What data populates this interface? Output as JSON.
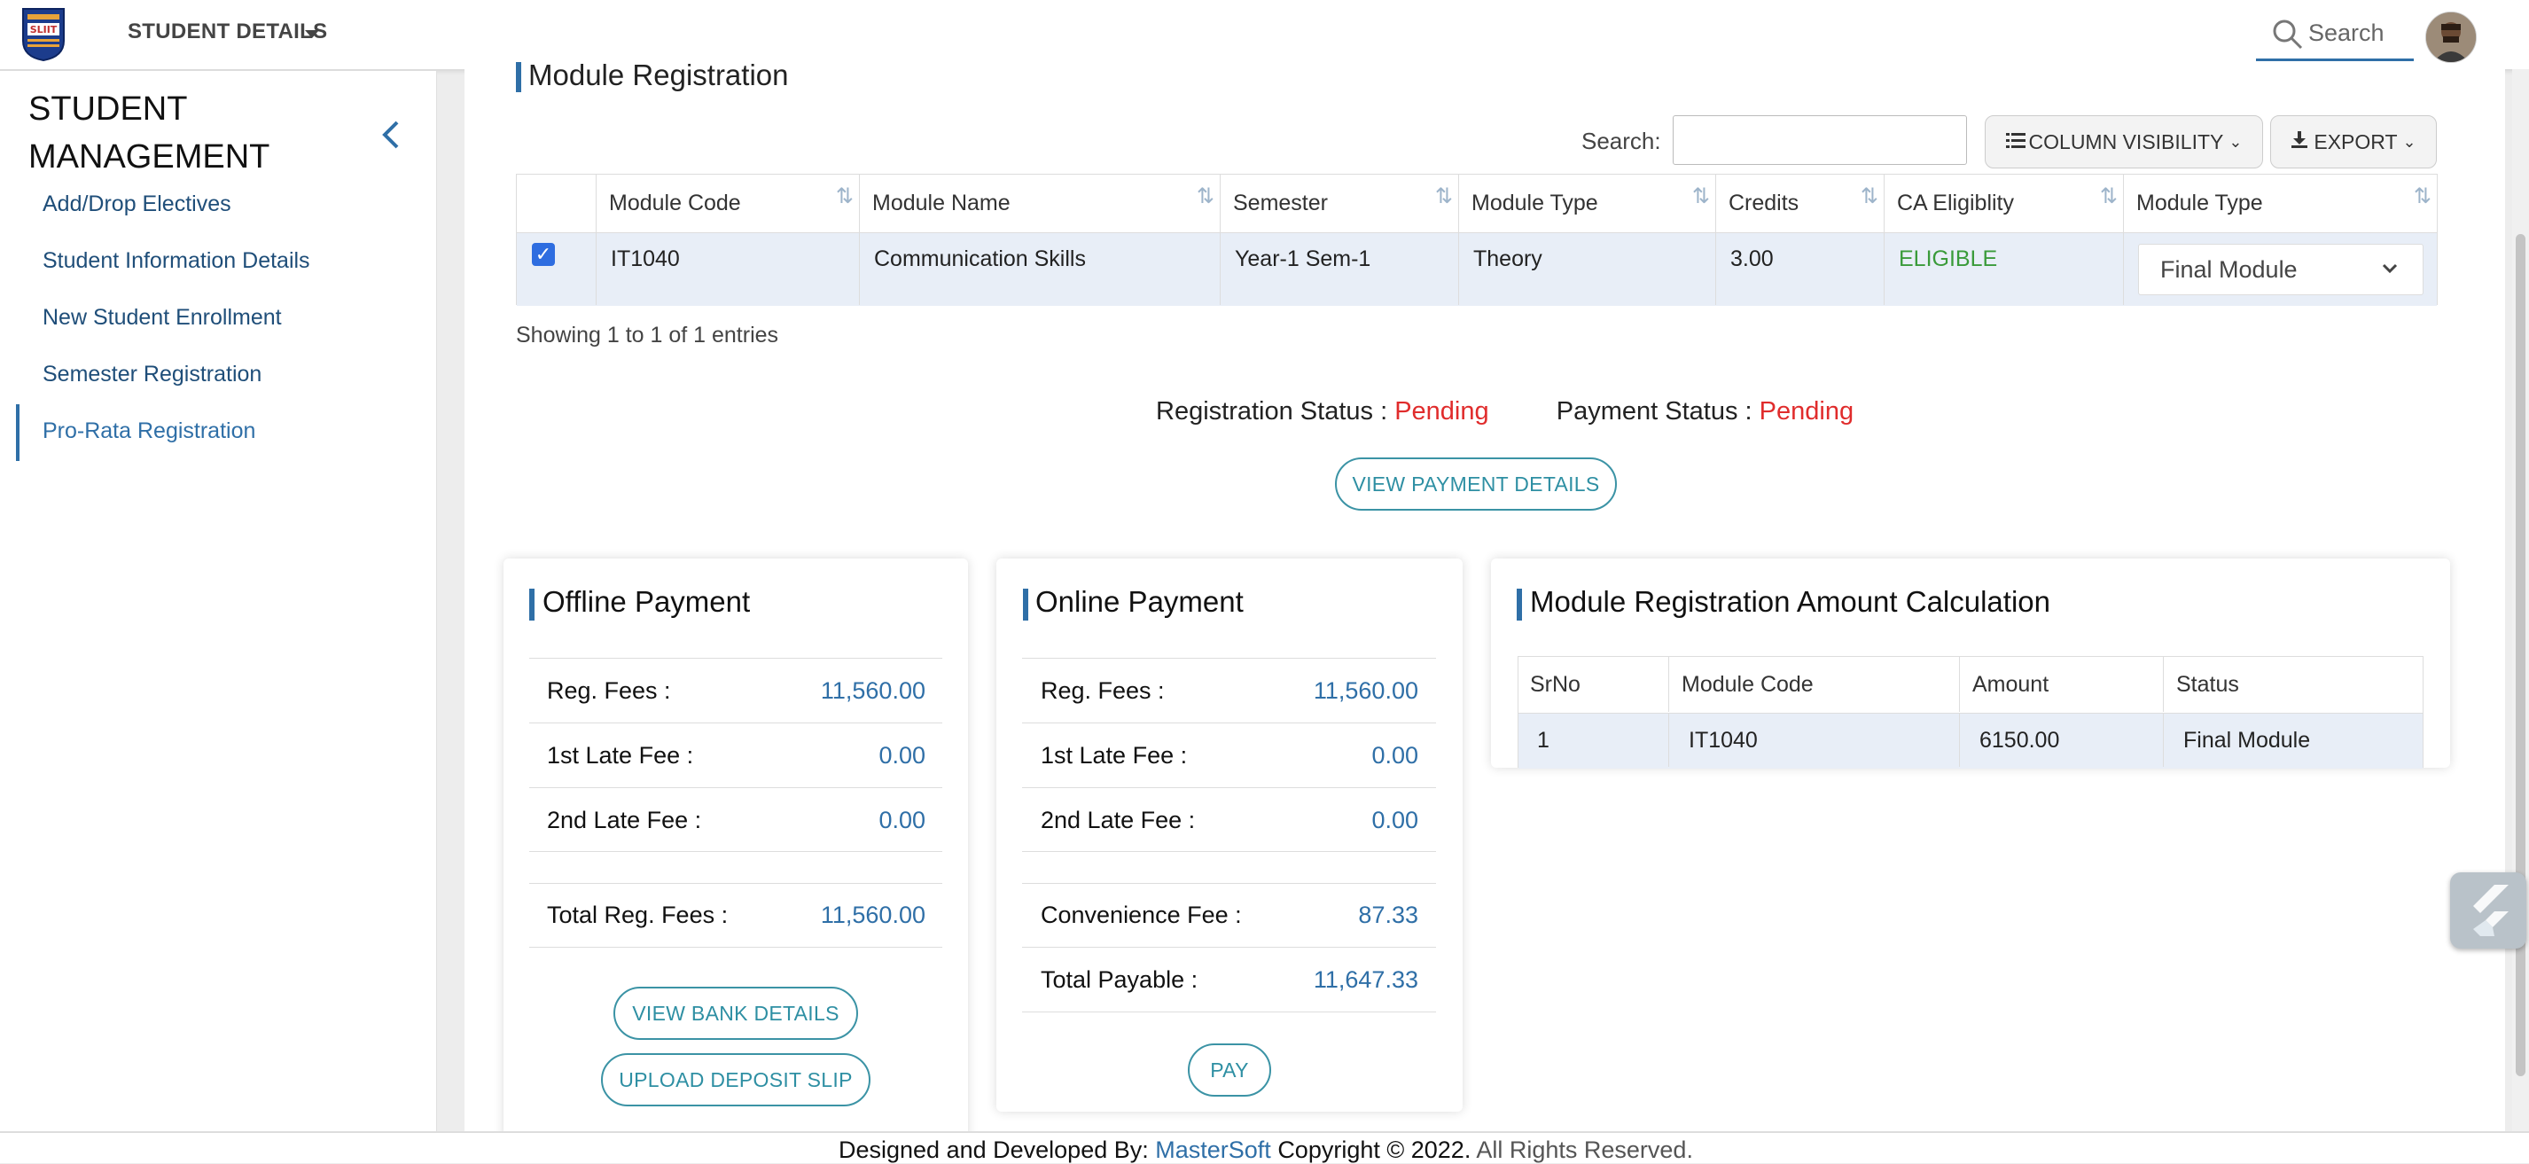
{
  "header": {
    "nav_title": "STUDENT DETAILS",
    "search_label": "Search"
  },
  "sidebar": {
    "title": "STUDENT MANAGEMENT",
    "items": [
      {
        "label": "Add/Drop Electives"
      },
      {
        "label": "Student Information Details"
      },
      {
        "label": "New Student Enrollment"
      },
      {
        "label": "Semester Registration"
      },
      {
        "label": "Pro-Rata Registration"
      }
    ],
    "active_index": 4
  },
  "main": {
    "page_title": "Module Registration",
    "search_label": "Search:",
    "search_value": "",
    "column_visibility_label": "COLUMN VISIBILITY",
    "export_label": "EXPORT",
    "table": {
      "headers": [
        "Module Code",
        "Module Name",
        "Semester",
        "Module Type",
        "Credits",
        "CA Eligiblity",
        "Module Type"
      ],
      "rows": [
        {
          "checked": true,
          "module_code": "IT1040",
          "module_name": "Communication Skills",
          "semester": "Year-1 Sem-1",
          "module_type": "Theory",
          "credits": "3.00",
          "ca_eligibility": "ELIGIBLE",
          "module_type_select": "Final Module"
        }
      ]
    },
    "showing_text": "Showing 1 to 1 of 1 entries",
    "registration_status_label": "Registration Status :",
    "registration_status_value": "Pending",
    "payment_status_label": "Payment Status :",
    "payment_status_value": "Pending",
    "view_payment_details_label": "VIEW PAYMENT DETAILS"
  },
  "offline_payment": {
    "title": "Offline Payment",
    "rows": [
      {
        "label": "Reg. Fees :",
        "value": "11,560.00"
      },
      {
        "label": "1st Late Fee :",
        "value": "0.00"
      },
      {
        "label": "2nd Late Fee :",
        "value": "0.00"
      },
      {
        "label": "Total Reg. Fees :",
        "value": "11,560.00"
      }
    ],
    "view_bank_details_label": "VIEW BANK DETAILS",
    "upload_deposit_slip_label": "UPLOAD DEPOSIT SLIP"
  },
  "online_payment": {
    "title": "Online Payment",
    "rows": [
      {
        "label": "Reg. Fees :",
        "value": "11,560.00"
      },
      {
        "label": "1st Late Fee :",
        "value": "0.00"
      },
      {
        "label": "2nd Late Fee :",
        "value": "0.00"
      },
      {
        "label": "Convenience Fee :",
        "value": "87.33"
      },
      {
        "label": "Total Payable :",
        "value": "11,647.33"
      }
    ],
    "pay_label": "PAY"
  },
  "amount_calc": {
    "title": "Module Registration Amount Calculation",
    "headers": [
      "SrNo",
      "Module Code",
      "Amount",
      "Status"
    ],
    "rows": [
      {
        "srno": "1",
        "module_code": "IT1040",
        "amount": "6150.00",
        "status": "Final Module"
      }
    ]
  },
  "footer": {
    "prefix": "Designed and Developed By:",
    "company": "MasterSoft",
    "copyright": "Copyright © 2022.",
    "rights": "All Rights Reserved."
  },
  "colors": {
    "accent": "#2f6fa7",
    "pending": "#e02c2c",
    "eligible": "#3a9b3a",
    "outline_button": "#3b93a5",
    "row_highlight": "#e8eef7"
  },
  "icons": {
    "logo": "university-logo-icon",
    "caret": "caret-down-icon",
    "search": "search-icon",
    "collapse": "chevron-left-icon",
    "sort": "sort-icon",
    "columns": "list-icon",
    "export": "download-icon",
    "float": "flutter-icon"
  }
}
